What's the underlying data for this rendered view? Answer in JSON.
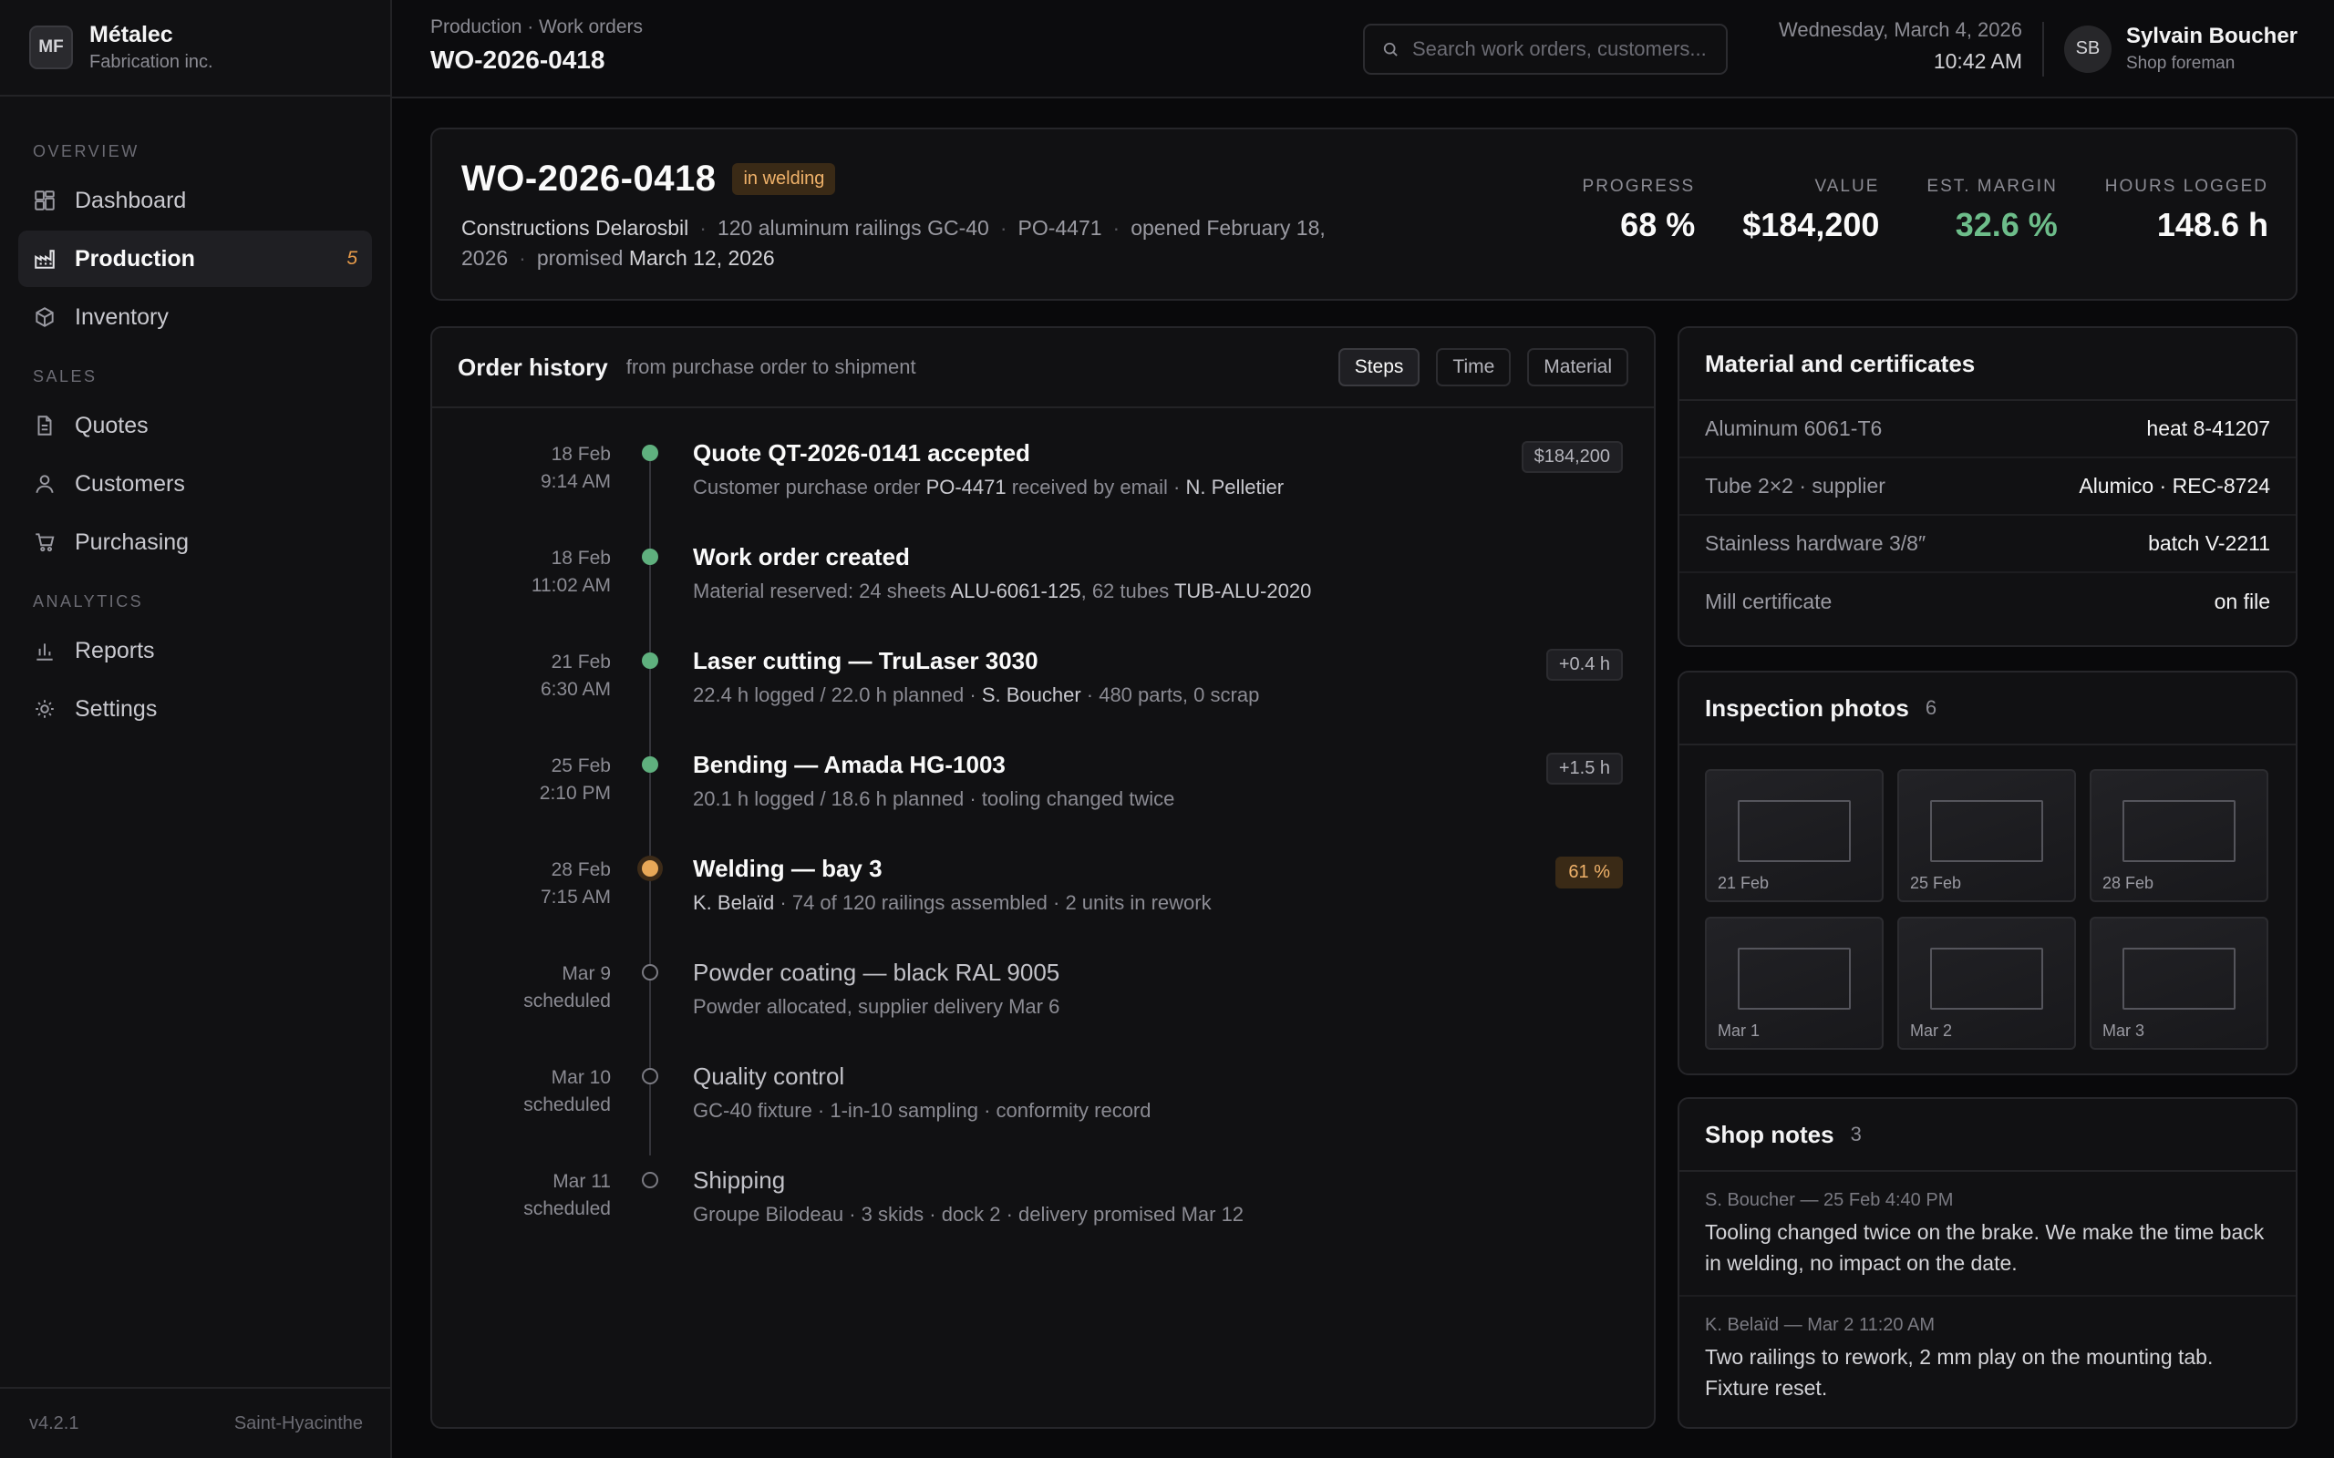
{
  "brand": {
    "logo": "MF",
    "name": "Métalec",
    "sub": "Fabrication inc."
  },
  "nav": {
    "overview_label": "OVERVIEW",
    "sales_label": "SALES",
    "analytics_label": "ANALYTICS",
    "items": {
      "dashboard": "Dashboard",
      "production": "Production",
      "production_badge": "5",
      "inventory": "Inventory",
      "quotes": "Quotes",
      "customers": "Customers",
      "purchasing": "Purchasing",
      "reports": "Reports",
      "settings": "Settings"
    }
  },
  "footer": {
    "version": "v4.2.1",
    "location": "Saint-Hyacinthe"
  },
  "topbar": {
    "breadcrumb": "Production · Work orders",
    "title": "WO-2026-0418",
    "search_placeholder": "Search work orders, customers...",
    "date": "Wednesday, March 4, 2026",
    "time": "10:42 AM"
  },
  "user": {
    "initials": "SB",
    "name": "Sylvain Boucher",
    "role": "Shop foreman"
  },
  "work_order": {
    "id": "WO-2026-0418",
    "status": "in welding",
    "customer": "Constructions Delarosbil",
    "description": "120 aluminum railings GC-40",
    "po": "PO-4471",
    "opened": "opened February 18, 2026",
    "promised_label": "promised",
    "promised_date": "March 12, 2026"
  },
  "stats": {
    "progress_label": "PROGRESS",
    "progress": "68 %",
    "value_label": "VALUE",
    "value": "$184,200",
    "margin_label": "EST. MARGIN",
    "margin": "32.6 %",
    "hours_label": "HOURS LOGGED",
    "hours": "148.6 h"
  },
  "history": {
    "title": "Order history",
    "subtitle": "from purchase order to shipment",
    "views": [
      "Steps",
      "Time",
      "Material"
    ],
    "steps": [
      {
        "date": "18 Feb",
        "time": "9:14 AM",
        "title": "Quote QT-2026-0141 accepted",
        "d1": "Customer purchase order ",
        "d1b": "PO-4471",
        "d2": " received by email · ",
        "d2b": "N. Pelletier",
        "d3": "",
        "tag": "$184,200"
      },
      {
        "date": "18 Feb",
        "time": "11:02 AM",
        "title": "Work order created",
        "d1": "Material reserved: 24 sheets ",
        "d1b": "ALU-6061-125",
        "d2": ", 62 tubes ",
        "d2b": "TUB-ALU-2020",
        "d3": "",
        "tag": ""
      },
      {
        "date": "21 Feb",
        "time": "6:30 AM",
        "title": "Laser cutting — TruLaser 3030",
        "d1": "22.4 h logged / 22.0 h planned · ",
        "d1b": "S. Boucher",
        "d2": " · 480 parts, 0 scrap",
        "d2b": "",
        "d3": "",
        "tag": "+0.4 h"
      },
      {
        "date": "25 Feb",
        "time": "2:10 PM",
        "title": "Bending — Amada HG-1003",
        "d1": "20.1 h logged / 18.6 h planned · tooling changed twice",
        "d1b": "",
        "d2": "",
        "d2b": "",
        "d3": "",
        "tag": "+1.5 h"
      },
      {
        "date": "28 Feb",
        "time": "7:15 AM",
        "title": "Welding — bay 3",
        "d1": "",
        "d1b": "K. Belaïd",
        "d2": " · 74 of 120 railings assembled · 2 units in rework",
        "d2b": "",
        "d3": "",
        "tag": "61 %"
      },
      {
        "date": "Mar 9",
        "time": "scheduled",
        "title": "Powder coating — black RAL 9005",
        "d1": "Powder allocated, supplier delivery Mar 6",
        "d1b": "",
        "d2": "",
        "d2b": "",
        "d3": "",
        "tag": ""
      },
      {
        "date": "Mar 10",
        "time": "scheduled",
        "title": "Quality control",
        "d1": "GC-40 fixture · 1-in-10 sampling · conformity record",
        "d1b": "",
        "d2": "",
        "d2b": "",
        "d3": "",
        "tag": ""
      },
      {
        "date": "Mar 11",
        "time": "scheduled",
        "title": "Shipping",
        "d1": "Groupe Bilodeau · 3 skids · dock 2 · delivery promised Mar 12",
        "d1b": "",
        "d2": "",
        "d2b": "",
        "d3": "",
        "tag": ""
      }
    ]
  },
  "materials": {
    "title": "Material and certificates",
    "rows": [
      {
        "key": "Aluminum 6061-T6",
        "value": "heat 8-41207"
      },
      {
        "key": "Tube 2×2 · supplier",
        "value": "Alumico · REC-8724"
      },
      {
        "key": "Stainless hardware 3/8″",
        "value": "batch V-2211"
      },
      {
        "key": "Mill certificate",
        "value": "on file"
      }
    ]
  },
  "photos": {
    "title": "Inspection photos",
    "count": "6",
    "items": [
      "21 Feb",
      "25 Feb",
      "28 Feb",
      "Mar 1",
      "Mar 2",
      "Mar 3"
    ]
  },
  "notes": {
    "title": "Shop notes",
    "count": "3",
    "items": [
      {
        "meta": "S. Boucher — 25 Feb 4:40 PM",
        "text": "Tooling changed twice on the brake. We make the time back in welding, no impact on the date."
      },
      {
        "meta": "K. Belaïd — Mar 2 11:20 AM",
        "text": "Two railings to rework, 2 mm play on the mounting tab. Fixture reset."
      }
    ]
  },
  "colors": {
    "accent_warn": "#f0b26a",
    "done": "#5fb07e",
    "margin_green": "#6dbd8a"
  }
}
